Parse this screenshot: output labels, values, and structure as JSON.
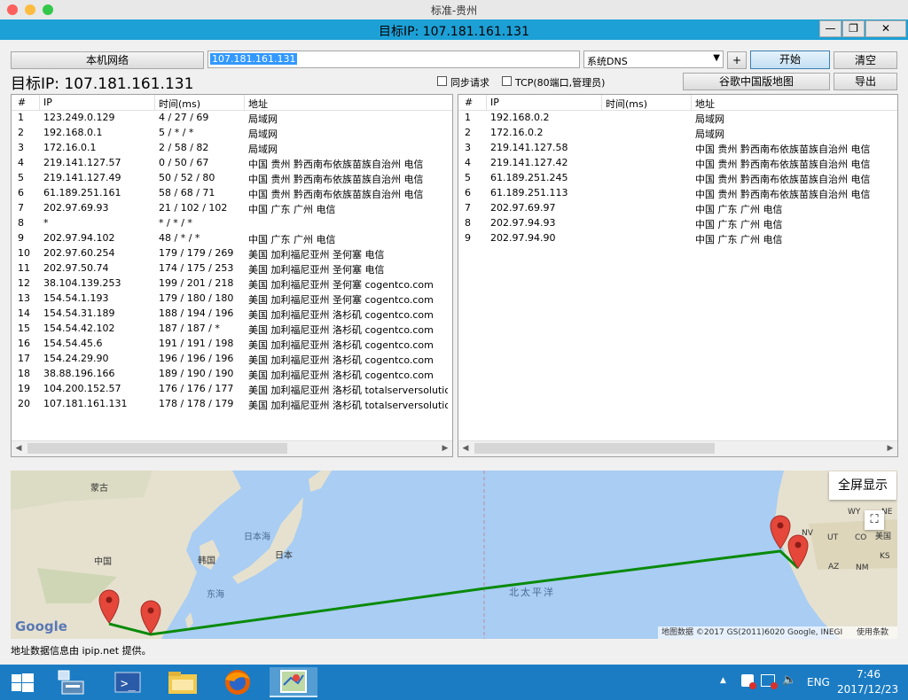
{
  "titlebar": {
    "title": "标准-贵州"
  },
  "window": {
    "title": "目标IP: 107.181.161.131"
  },
  "toolbar": {
    "local_network_label": "本机网络",
    "target_input_value": "107.181.161.131",
    "dns_select_value": "系统DNS",
    "add_label": "+",
    "start_label": "开始",
    "clear_label": "清空",
    "target_display": "目标IP:  107.181.161.131",
    "sync_request_label": "同步请求",
    "tcp_label": "TCP(80端口,管理员)",
    "google_map_label": "谷歌中国版地图",
    "export_label": "导出"
  },
  "left_table": {
    "headers": [
      "#",
      "IP",
      "时间(ms)",
      "地址"
    ],
    "rows": [
      [
        "1",
        "123.249.0.129",
        "4 / 27 / 69",
        "局域网"
      ],
      [
        "2",
        "192.168.0.1",
        "5 / * / *",
        "局域网"
      ],
      [
        "3",
        "172.16.0.1",
        "2 / 58 / 82",
        "局域网"
      ],
      [
        "4",
        "219.141.127.57",
        "0 / 50 / 67",
        "中国 贵州 黔西南布依族苗族自治州 电信"
      ],
      [
        "5",
        "219.141.127.49",
        "50 / 52 / 80",
        "中国 贵州 黔西南布依族苗族自治州 电信"
      ],
      [
        "6",
        "61.189.251.161",
        "58 / 68 / 71",
        "中国 贵州 黔西南布依族苗族自治州 电信"
      ],
      [
        "7",
        "202.97.69.93",
        "21 / 102 / 102",
        "中国 广东 广州 电信"
      ],
      [
        "8",
        "*",
        "* / * / *",
        ""
      ],
      [
        "9",
        "202.97.94.102",
        "48 / * / *",
        "中国 广东 广州 电信"
      ],
      [
        "10",
        "202.97.60.254",
        "179 / 179 / 269",
        "美国 加利福尼亚州 圣何塞 电信"
      ],
      [
        "11",
        "202.97.50.74",
        "174 / 175 / 253",
        "美国 加利福尼亚州 圣何塞 电信"
      ],
      [
        "12",
        "38.104.139.253",
        "199 / 201 / 218",
        "美国 加利福尼亚州 圣何塞 cogentco.com"
      ],
      [
        "13",
        "154.54.1.193",
        "179 / 180 / 180",
        "美国 加利福尼亚州 圣何塞 cogentco.com"
      ],
      [
        "14",
        "154.54.31.189",
        "188 / 194 / 196",
        "美国 加利福尼亚州 洛杉矶 cogentco.com"
      ],
      [
        "15",
        "154.54.42.102",
        "187 / 187 / *",
        "美国 加利福尼亚州 洛杉矶 cogentco.com"
      ],
      [
        "16",
        "154.54.45.6",
        "191 / 191 / 198",
        "美国 加利福尼亚州 洛杉矶 cogentco.com"
      ],
      [
        "17",
        "154.24.29.90",
        "196 / 196 / 196",
        "美国 加利福尼亚州 洛杉矶 cogentco.com"
      ],
      [
        "18",
        "38.88.196.166",
        "189 / 190 / 190",
        "美国 加利福尼亚州 洛杉矶 cogentco.com"
      ],
      [
        "19",
        "104.200.152.57",
        "176 / 176 / 177",
        "美国 加利福尼亚州 洛杉矶 totalserversolutio."
      ],
      [
        "20",
        "107.181.161.131",
        "178 / 178 / 179",
        "美国 加利福尼亚州 洛杉矶 totalserversolutio."
      ]
    ]
  },
  "right_table": {
    "headers": [
      "#",
      "IP",
      "时间(ms)",
      "地址"
    ],
    "rows": [
      [
        "1",
        "192.168.0.2",
        "",
        "局域网"
      ],
      [
        "2",
        "172.16.0.2",
        "",
        "局域网"
      ],
      [
        "3",
        "219.141.127.58",
        "",
        "中国 贵州 黔西南布依族苗族自治州 电信"
      ],
      [
        "4",
        "219.141.127.42",
        "",
        "中国 贵州 黔西南布依族苗族自治州 电信"
      ],
      [
        "5",
        "61.189.251.245",
        "",
        "中国 贵州 黔西南布依族苗族自治州 电信"
      ],
      [
        "6",
        "61.189.251.113",
        "",
        "中国 贵州 黔西南布依族苗族自治州 电信"
      ],
      [
        "7",
        "202.97.69.97",
        "",
        "中国 广东 广州 电信"
      ],
      [
        "8",
        "202.97.94.93",
        "",
        "中国 广东 广州 电信"
      ],
      [
        "9",
        "202.97.94.90",
        "",
        "中国 广东 广州 电信"
      ]
    ]
  },
  "map": {
    "fullscreen_label": "全屏显示",
    "labels": {
      "mongolia": "蒙古",
      "china": "中国",
      "sea_of_japan": "日本海",
      "japan": "日本",
      "korea": "韩国",
      "east_sea": "东海",
      "north_pacific": "北太平洋",
      "usa": "美国",
      "wy": "WY",
      "ut": "UT",
      "nv": "NV",
      "co": "CO",
      "az": "AZ",
      "nm": "NM",
      "ne": "NE",
      "ks": "KS"
    },
    "google_logo": "Google",
    "attribution": "地图数据 ©2017 GS(2011)6020 Google, INEGI",
    "terms": "使用条款"
  },
  "status": {
    "text": "地址数据信息由 ipip.net 提供。"
  },
  "taskbar": {
    "lang": "ENG",
    "time": "7:46",
    "date": "2017/12/23"
  },
  "colors": {
    "window_accent": "#1ca0d6",
    "taskbar": "#1b7cc4",
    "route": "#0a8a0a",
    "marker": "#e5473b",
    "water": "#a9cdf3"
  }
}
